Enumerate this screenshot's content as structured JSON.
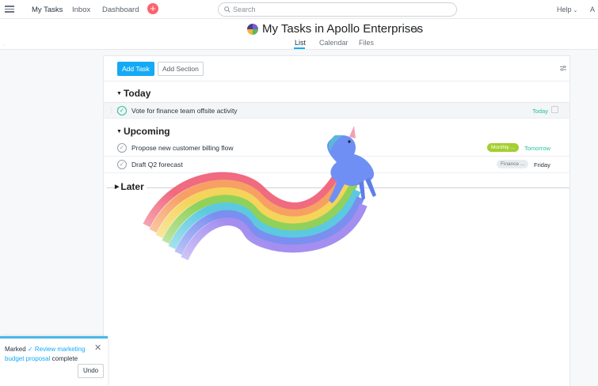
{
  "topbar": {
    "nav": [
      {
        "label": "My Tasks"
      },
      {
        "label": "Inbox"
      },
      {
        "label": "Dashboard"
      }
    ],
    "add_symbol": "+",
    "search_placeholder": "Search",
    "help_label": "Help",
    "user_initial": "A"
  },
  "header": {
    "title": "My Tasks in Apollo Enterprises",
    "tabs": [
      {
        "label": "List"
      },
      {
        "label": "Calendar"
      },
      {
        "label": "Files"
      }
    ],
    "active_tab": "List"
  },
  "toolbar": {
    "add_task_label": "Add Task",
    "add_section_label": "Add Section"
  },
  "sections": [
    {
      "title": "Today",
      "tasks": [
        {
          "name": "Vote for finance team offsite activity",
          "due": "Today",
          "due_color": "#25c2a0",
          "completed": true
        }
      ]
    },
    {
      "title": "Upcoming",
      "tasks": [
        {
          "name": "Propose new customer billing flow",
          "tag": "Monthly ...",
          "tag_color": "#a4cf30",
          "due": "Tomorrow",
          "due_color": "#25c2a0",
          "completed": false
        },
        {
          "name": "Draft Q2 forecast",
          "tag": "Finance ...",
          "tag_color": "#e8ecee",
          "due": "Friday",
          "due_color": "#273240",
          "completed": false
        }
      ]
    },
    {
      "title": "Later",
      "tasks": []
    }
  ],
  "toast": {
    "prefix": "Marked",
    "check": "✓",
    "link_text": "Review marketing budget proposal",
    "suffix": "complete",
    "undo_label": "Undo"
  },
  "colors": {
    "accent": "#14aaf5",
    "add_button": "#fc636b",
    "due_green": "#25c2a0",
    "tag_green": "#a4cf30"
  }
}
